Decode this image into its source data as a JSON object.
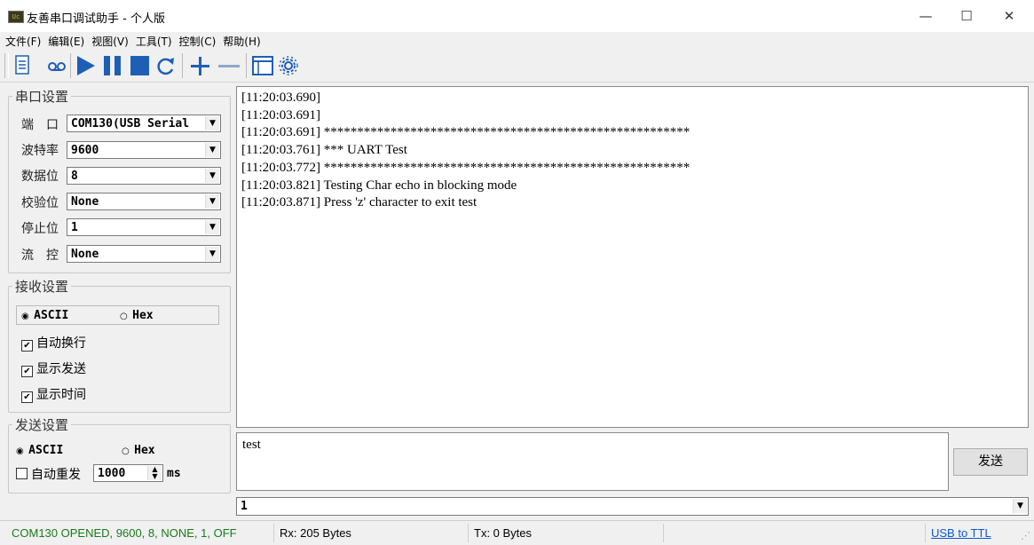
{
  "window": {
    "title": "友善串口调试助手 - 个人版",
    "icon_label": "Uc",
    "minimize_glyph": "—",
    "maximize_glyph": "☐",
    "close_glyph": "✕"
  },
  "menu": [
    "文件(F)",
    "编辑(E)",
    "视图(V)",
    "工具(T)",
    "控制(C)",
    "帮助(H)"
  ],
  "toolbar": {
    "icons": [
      "document-icon",
      "record-icon",
      "play-icon",
      "pause-icon",
      "stop-icon",
      "refresh-icon",
      "add-icon",
      "remove-icon",
      "window-icon",
      "settings-icon"
    ],
    "accent": "#1e5fb5"
  },
  "serial": {
    "legend": "串口设置",
    "rows": [
      {
        "label": "端　口",
        "value": "COM130(USB Serial"
      },
      {
        "label": "波特率",
        "value": "9600"
      },
      {
        "label": "数据位",
        "value": "8"
      },
      {
        "label": "校验位",
        "value": "None"
      },
      {
        "label": "停止位",
        "value": "1"
      },
      {
        "label": "流　控",
        "value": "None"
      }
    ]
  },
  "receive": {
    "legend": "接收设置",
    "mode_ascii": "ASCII",
    "mode_hex": "Hex",
    "selected_mode": "ASCII",
    "options": [
      {
        "label": "自动换行",
        "checked": true
      },
      {
        "label": "显示发送",
        "checked": true
      },
      {
        "label": "显示时间",
        "checked": true
      }
    ]
  },
  "send": {
    "legend": "发送设置",
    "mode_ascii": "ASCII",
    "mode_hex": "Hex",
    "selected_mode": "ASCII",
    "auto_resend_label": "自动重发",
    "auto_resend_checked": false,
    "interval": "1000",
    "unit": "ms",
    "input_text": "test",
    "button_label": "发送",
    "history_value": "1"
  },
  "log": [
    "[11:20:03.690]",
    "[11:20:03.691]",
    "[11:20:03.691] *******************************************************",
    "[11:20:03.761] *** UART Test",
    "[11:20:03.772] *******************************************************",
    "[11:20:03.821] Testing Char echo in blocking mode",
    "[11:20:03.871] Press 'z' character to exit test"
  ],
  "status": {
    "connection": "COM130 OPENED, 9600, 8, NONE, 1, OFF",
    "rx": "Rx: 205 Bytes",
    "tx": "Tx: 0 Bytes",
    "link": "USB to TTL",
    "connection_color": "#1a7a1a",
    "link_color": "#0b5ad6"
  }
}
